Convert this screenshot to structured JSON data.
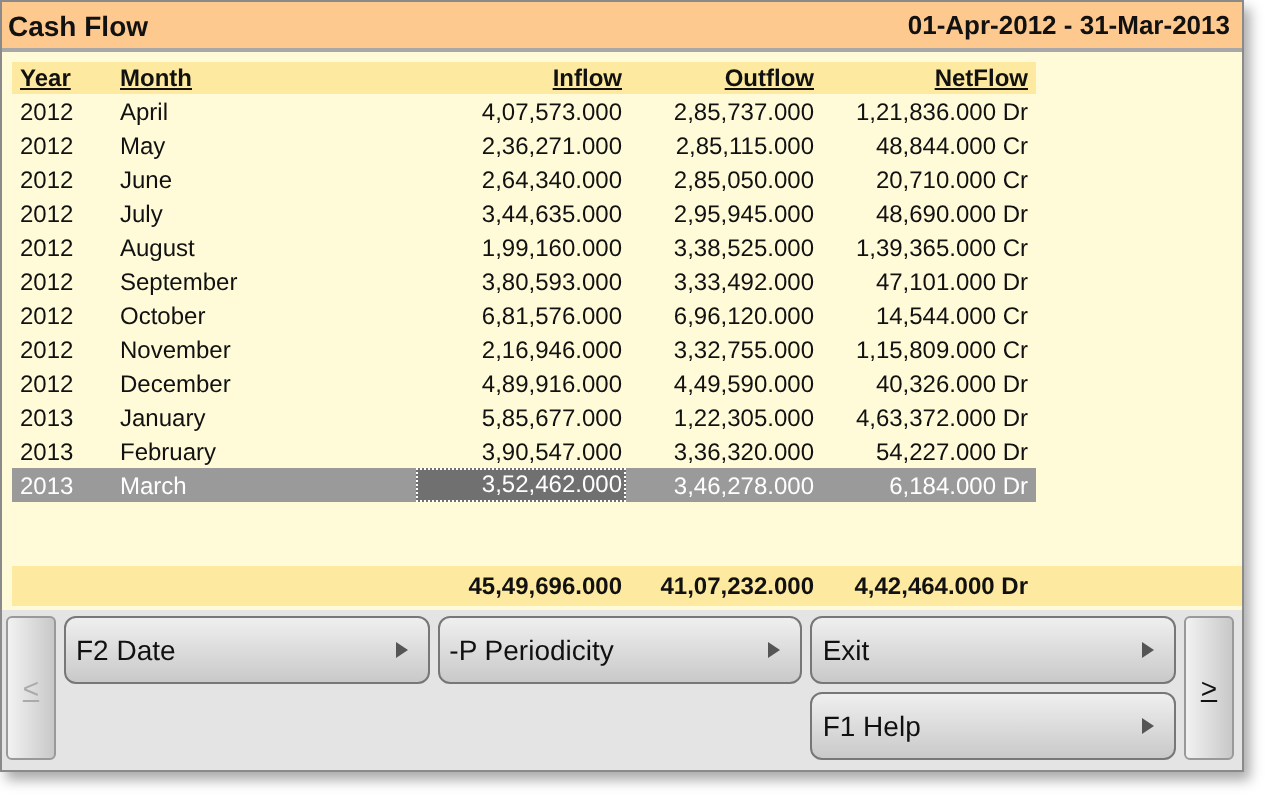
{
  "window": {
    "title": "Cash Flow",
    "period": "01-Apr-2012 - 31-Mar-2013"
  },
  "table": {
    "columns": [
      "Year",
      "Month",
      "Inflow",
      "Outflow",
      "NetFlow"
    ],
    "rows": [
      {
        "year": "2012",
        "month": "April",
        "inflow": "4,07,573.000",
        "outflow": "2,85,737.000",
        "netflow": "1,21,836.000 Dr",
        "selected": false
      },
      {
        "year": "2012",
        "month": "May",
        "inflow": "2,36,271.000",
        "outflow": "2,85,115.000",
        "netflow": "48,844.000 Cr",
        "selected": false
      },
      {
        "year": "2012",
        "month": "June",
        "inflow": "2,64,340.000",
        "outflow": "2,85,050.000",
        "netflow": "20,710.000 Cr",
        "selected": false
      },
      {
        "year": "2012",
        "month": "July",
        "inflow": "3,44,635.000",
        "outflow": "2,95,945.000",
        "netflow": "48,690.000 Dr",
        "selected": false
      },
      {
        "year": "2012",
        "month": "August",
        "inflow": "1,99,160.000",
        "outflow": "3,38,525.000",
        "netflow": "1,39,365.000 Cr",
        "selected": false
      },
      {
        "year": "2012",
        "month": "September",
        "inflow": "3,80,593.000",
        "outflow": "3,33,492.000",
        "netflow": "47,101.000 Dr",
        "selected": false
      },
      {
        "year": "2012",
        "month": "October",
        "inflow": "6,81,576.000",
        "outflow": "6,96,120.000",
        "netflow": "14,544.000 Cr",
        "selected": false
      },
      {
        "year": "2012",
        "month": "November",
        "inflow": "2,16,946.000",
        "outflow": "3,32,755.000",
        "netflow": "1,15,809.000 Cr",
        "selected": false
      },
      {
        "year": "2012",
        "month": "December",
        "inflow": "4,89,916.000",
        "outflow": "4,49,590.000",
        "netflow": "40,326.000 Dr",
        "selected": false
      },
      {
        "year": "2013",
        "month": "January",
        "inflow": "5,85,677.000",
        "outflow": "1,22,305.000",
        "netflow": "4,63,372.000 Dr",
        "selected": false
      },
      {
        "year": "2013",
        "month": "February",
        "inflow": "3,90,547.000",
        "outflow": "3,36,320.000",
        "netflow": "54,227.000 Dr",
        "selected": false
      },
      {
        "year": "2013",
        "month": "March",
        "inflow": "3,52,462.000",
        "outflow": "3,46,278.000",
        "netflow": "6,184.000 Dr",
        "selected": true
      }
    ],
    "totals": {
      "inflow": "45,49,696.000",
      "outflow": "41,07,232.000",
      "netflow": "4,42,464.000 Dr"
    }
  },
  "scroll_left": {
    "label": "<",
    "disabled": true
  },
  "scroll_right": {
    "label": ">",
    "disabled": false
  },
  "buttons": [
    {
      "label": "F2 Date"
    },
    {
      "label": "-P Periodicity"
    },
    {
      "label": "Exit"
    }
  ],
  "help_button": {
    "label": "F1 Help"
  }
}
